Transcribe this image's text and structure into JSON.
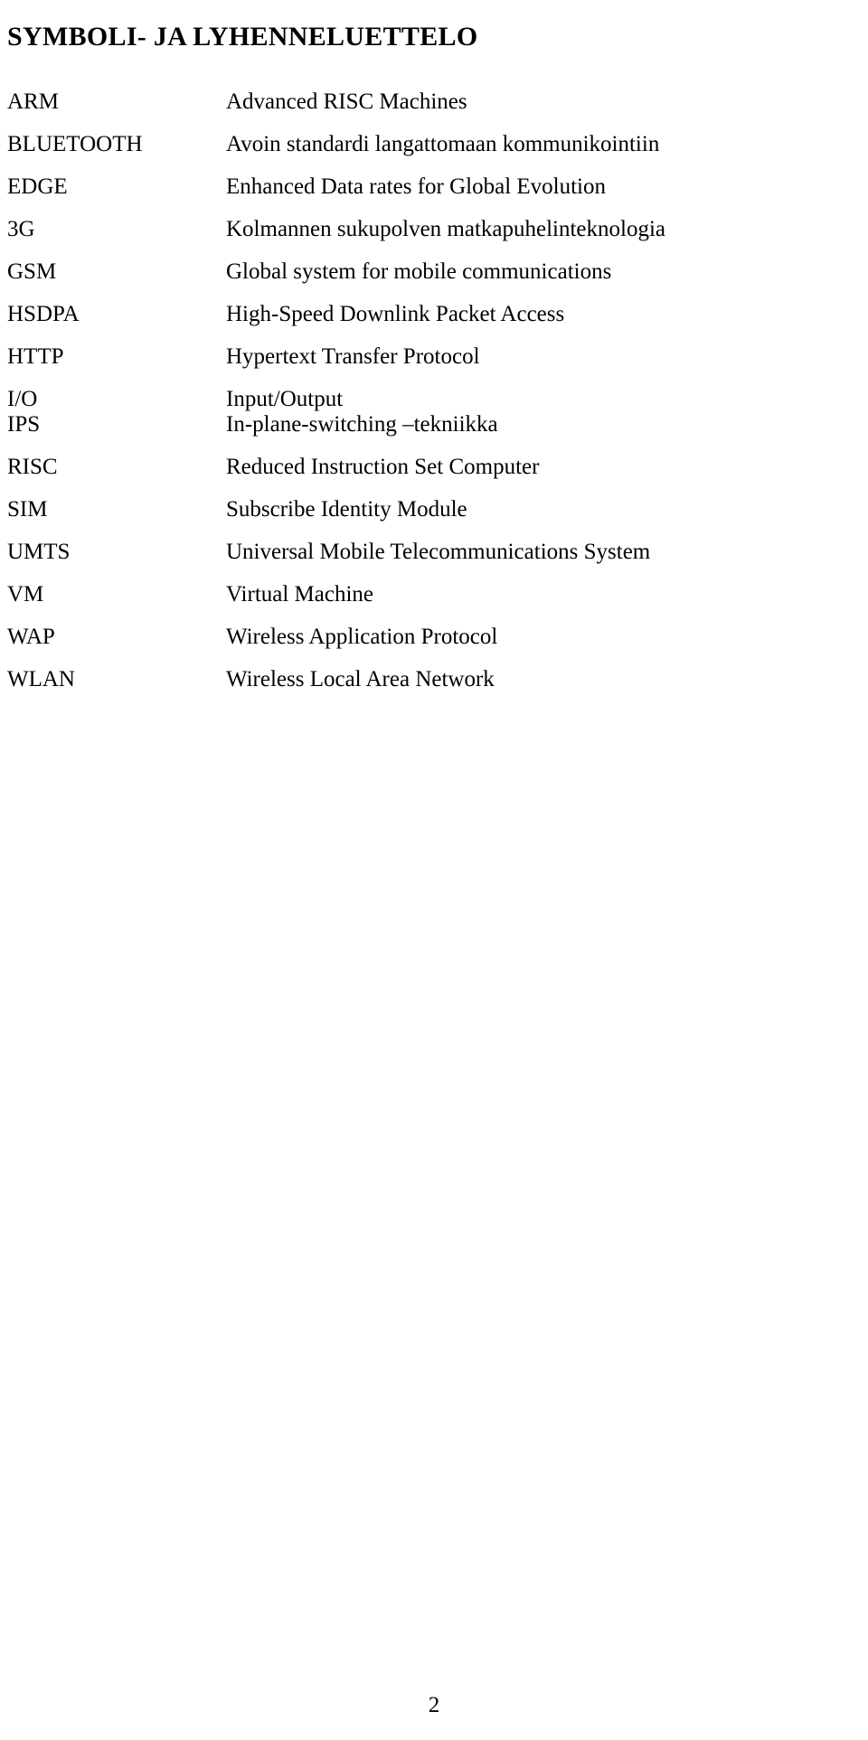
{
  "document": {
    "title": "SYMBOLI- JA LYHENNELUETTELO",
    "page_number": "2"
  },
  "abbreviations": [
    {
      "term": "ARM",
      "description": "Advanced RISC Machines",
      "tight": false
    },
    {
      "term": "BLUETOOTH",
      "description": "Avoin standardi langattomaan kommunikointiin",
      "tight": false
    },
    {
      "term": "EDGE",
      "description": "Enhanced Data rates for Global Evolution",
      "tight": false
    },
    {
      "term": "3G",
      "description": "Kolmannen sukupolven matkapuhelinteknologia",
      "tight": false
    },
    {
      "term": "GSM",
      "description": "Global system for mobile communications",
      "tight": false
    },
    {
      "term": "HSDPA",
      "description": "High-Speed Downlink Packet Access",
      "tight": false
    },
    {
      "term": "HTTP",
      "description": "Hypertext Transfer Protocol",
      "tight": false
    },
    {
      "term": "I/O",
      "description": "Input/Output",
      "tight": true
    },
    {
      "term": "IPS",
      "description": "In-plane-switching –tekniikka",
      "tight": false
    },
    {
      "term": "RISC",
      "description": "Reduced Instruction Set Computer",
      "tight": false
    },
    {
      "term": "SIM",
      "description": "Subscribe Identity Module",
      "tight": false
    },
    {
      "term": "UMTS",
      "description": "Universal Mobile Telecommunications System",
      "tight": false
    },
    {
      "term": "VM",
      "description": "Virtual Machine",
      "tight": false
    },
    {
      "term": "WAP",
      "description": "Wireless Application Protocol",
      "tight": false
    },
    {
      "term": "WLAN",
      "description": "Wireless Local Area Network",
      "tight": false
    }
  ]
}
